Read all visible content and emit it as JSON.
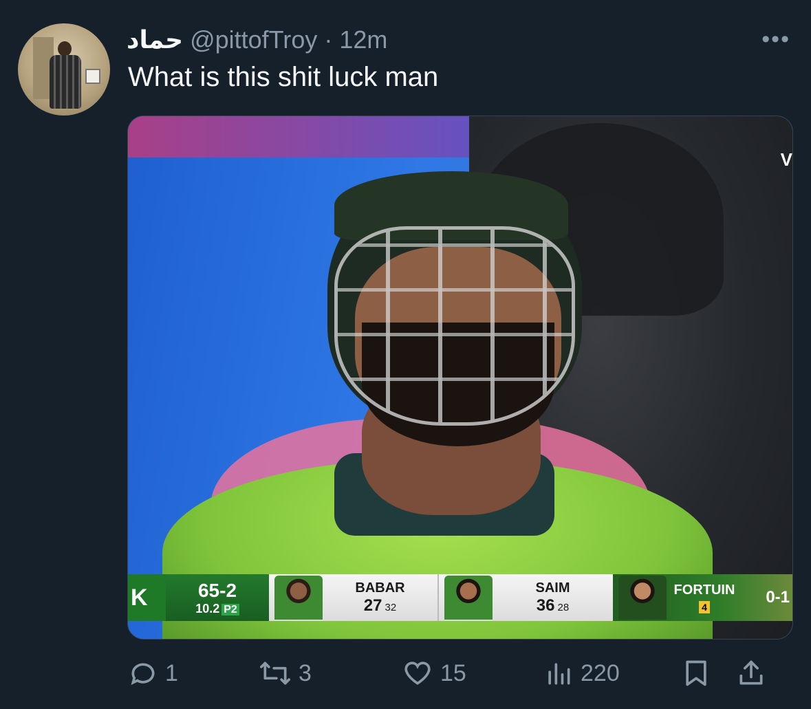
{
  "tweet": {
    "author_name": "حماد",
    "handle": "@pittofTroy",
    "separator": "·",
    "time": "12m",
    "more_label": "•••",
    "text": "What is this shit luck man"
  },
  "media": {
    "corner_text": "V",
    "scoreboard": {
      "team_letter": "K",
      "score": "65-2",
      "overs": "10.2",
      "phase": "P2",
      "batter1": {
        "name": "BABAR",
        "runs": "27",
        "balls": "32"
      },
      "batter2": {
        "name": "SAIM",
        "runs": "36",
        "balls": "28"
      },
      "bowler": {
        "name": "FORTUIN",
        "figures": "4",
        "result": "0-1"
      }
    }
  },
  "actions": {
    "replies": "1",
    "retweets": "3",
    "likes": "15",
    "views": "220"
  },
  "colors": {
    "background": "#15202b",
    "primary_text": "#f7f9f9",
    "secondary_text": "#8b98a5"
  }
}
